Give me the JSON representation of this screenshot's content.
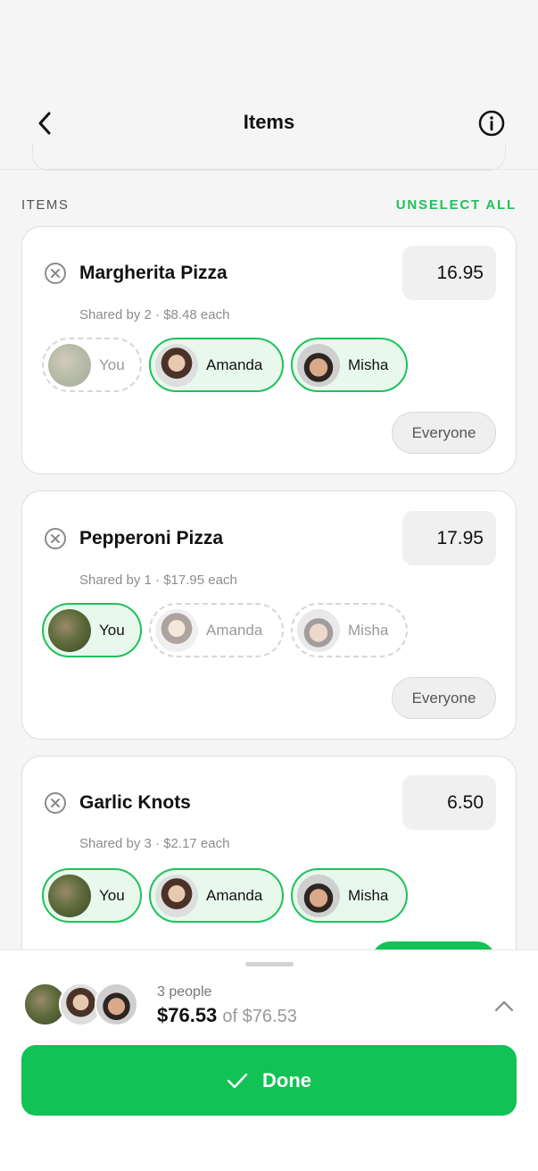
{
  "header": {
    "title": "Items",
    "back_icon": "chevron-left-icon",
    "info_icon": "info-circle-icon"
  },
  "section": {
    "label": "ITEMS",
    "unselect_all": "UNSELECT ALL"
  },
  "items": [
    {
      "name": "Margherita Pizza",
      "price": "16.95",
      "share_info": "Shared by 2 · $8.48 each",
      "people": [
        {
          "name": "You",
          "selected": false
        },
        {
          "name": "Amanda",
          "selected": true
        },
        {
          "name": "Misha",
          "selected": true
        }
      ],
      "everyone_label": "Everyone"
    },
    {
      "name": "Pepperoni Pizza",
      "price": "17.95",
      "share_info": "Shared by 1 · $17.95 each",
      "people": [
        {
          "name": "You",
          "selected": true
        },
        {
          "name": "Amanda",
          "selected": false
        },
        {
          "name": "Misha",
          "selected": false
        }
      ],
      "everyone_label": "Everyone"
    },
    {
      "name": "Garlic Knots",
      "price": "6.50",
      "share_info": "Shared by 3 · $2.17 each",
      "people": [
        {
          "name": "You",
          "selected": true
        },
        {
          "name": "Amanda",
          "selected": true
        },
        {
          "name": "Misha",
          "selected": true
        }
      ]
    }
  ],
  "summary": {
    "people_count": "3 people",
    "total": "$76.53",
    "of_total": "of $76.53",
    "chevron_icon": "chevron-up-icon"
  },
  "done_button": {
    "label": "Done",
    "icon": "check-icon"
  },
  "colors": {
    "accent": "#1ec25a",
    "button": "#11c254",
    "background": "#f5f5f5"
  }
}
